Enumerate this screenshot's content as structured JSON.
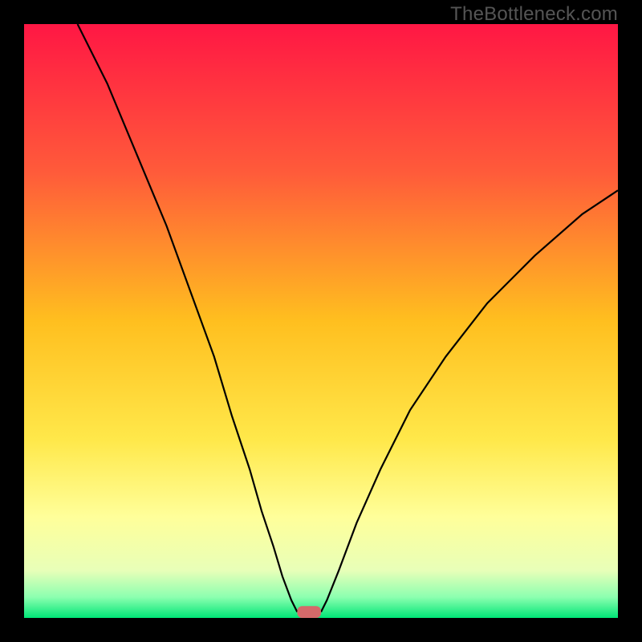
{
  "watermark": "TheBottleneck.com",
  "chart_data": {
    "type": "line",
    "title": "",
    "xlabel": "",
    "ylabel": "",
    "xlim": [
      0,
      100
    ],
    "ylim": [
      0,
      100
    ],
    "gradient_stops": [
      {
        "offset": 0,
        "color": "#ff1744"
      },
      {
        "offset": 0.25,
        "color": "#ff5b3a"
      },
      {
        "offset": 0.5,
        "color": "#ffbf1f"
      },
      {
        "offset": 0.7,
        "color": "#ffe84a"
      },
      {
        "offset": 0.83,
        "color": "#ffff9a"
      },
      {
        "offset": 0.92,
        "color": "#e8ffb8"
      },
      {
        "offset": 0.965,
        "color": "#8cffb0"
      },
      {
        "offset": 1.0,
        "color": "#00e676"
      }
    ],
    "curve_left": [
      {
        "x": 9,
        "y": 100
      },
      {
        "x": 14,
        "y": 90
      },
      {
        "x": 19,
        "y": 78
      },
      {
        "x": 24,
        "y": 66
      },
      {
        "x": 28,
        "y": 55
      },
      {
        "x": 32,
        "y": 44
      },
      {
        "x": 35,
        "y": 34
      },
      {
        "x": 38,
        "y": 25
      },
      {
        "x": 40,
        "y": 18
      },
      {
        "x": 42,
        "y": 12
      },
      {
        "x": 43.5,
        "y": 7
      },
      {
        "x": 45,
        "y": 3
      },
      {
        "x": 46,
        "y": 1
      }
    ],
    "curve_right": [
      {
        "x": 50,
        "y": 1
      },
      {
        "x": 51,
        "y": 3
      },
      {
        "x": 53,
        "y": 8
      },
      {
        "x": 56,
        "y": 16
      },
      {
        "x": 60,
        "y": 25
      },
      {
        "x": 65,
        "y": 35
      },
      {
        "x": 71,
        "y": 44
      },
      {
        "x": 78,
        "y": 53
      },
      {
        "x": 86,
        "y": 61
      },
      {
        "x": 94,
        "y": 68
      },
      {
        "x": 100,
        "y": 72
      }
    ],
    "marker": {
      "x_center": 48,
      "width": 4,
      "height": 2,
      "color": "#d46a6a"
    }
  }
}
